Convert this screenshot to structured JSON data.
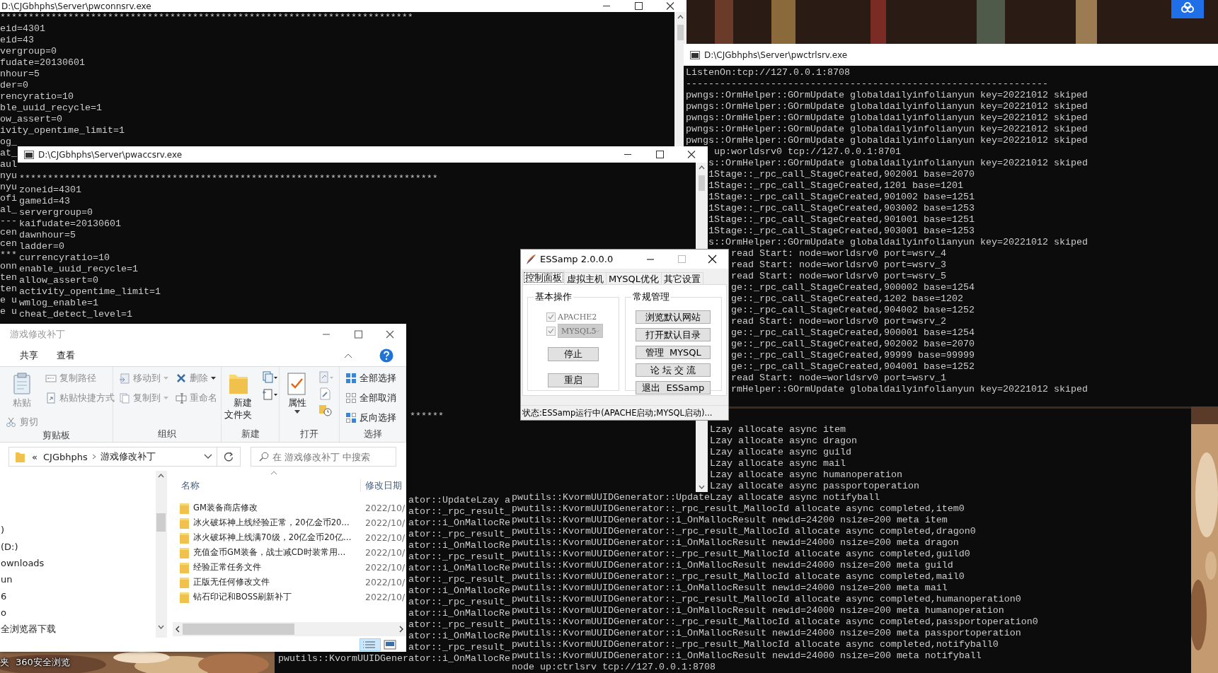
{
  "desktop": {
    "kind": "picture",
    "labels": [
      "夹",
      "360安全浏览"
    ]
  },
  "consoles": [
    {
      "title": "D:\\CJGbhphs\\Server\\pwconnsrv.exe",
      "segments": [
        {
          "lines": [
            "*************************************************************************",
            "eid=4301",
            "eid=43",
            "vergroup=0",
            "fudate=20130601",
            "nhour=5",
            "der=0",
            "rencyratio=10",
            "ble_uuid_recycle=1",
            "ow_assert=0",
            "ivity_opentime_limit=1"
          ]
        },
        {
          "lines": [
            "og_",
            "at_",
            "aul",
            "nyu",
            "nyu",
            "ofi",
            "al_",
            "---",
            "cen",
            "cen",
            "***",
            "onn",
            "ten",
            "ten",
            "e u",
            "e u"
          ]
        }
      ]
    },
    {
      "title": "D:\\CJGbhphs\\Server\\pwaccsrv.exe",
      "segments": [
        {
          "lines": [
            "**************************************************************************",
            "zoneid=4301",
            "gameid=43",
            "servergroup=0",
            "kaifudate=20130601",
            "dawnhour=5",
            "ladder=0",
            "currencyratio=10",
            "enable_uuid_recycle=1",
            "allow_assert=0",
            "activity_opentime_limit=1",
            "wmlog_enable=1",
            "cheat_detect_level=1"
          ]
        },
        {
          "lines": [
            "******"
          ]
        }
      ]
    },
    {
      "title": "D:\\CJGbhphs\\Server\\pwctrlsrv.exe",
      "segments": [
        {
          "lines": [
            "ListenOn:tcp://127.0.0.1:8708",
            "----------------------------------------------------------------",
            "pwngs::OrmHelper::GOrmUpdate globaldailyinfolianyun key=20221012 skiped",
            "pwngs::OrmHelper::GOrmUpdate globaldailyinfolianyun key=20221012 skiped",
            "pwngs::OrmHelper::GOrmUpdate globaldailyinfolianyun key=20221012 skiped",
            "pwngs::OrmHelper::GOrmUpdate globaldailyinfolianyun key=20221012 skiped",
            "pwngs::OrmHelper::GOrmUpdate globaldailyinfolianyun key=20221012 skiped"
          ]
        },
        {
          "lines": [
            " up:worldsrv0 tcp://127.0.0.1:8701",
            "s::OrmHelper::GOrmUpdate globaldailyinfolianyun key=20221012 skiped",
            "1Stage::_rpc_call_StageCreated,902001 base=2070",
            "1Stage::_rpc_call_StageCreated,1201 base=1201",
            "1Stage::_rpc_call_StageCreated,901002 base=1251",
            "1Stage::_rpc_call_StageCreated,903002 base=1253",
            "1Stage::_rpc_call_StageCreated,901001 base=1251",
            "1Stage::_rpc_call_StageCreated,903001 base=1253",
            "s::OrmHelper::GOrmUpdate globaldailyinfolianyun key=20221012 skiped"
          ]
        },
        {
          "lines": [
            "read Start: node=worldsrv0 port=wsrv_4",
            "read Start: node=worldsrv0 port=wsrv_3",
            "read Start: node=worldsrv0 port=wsrv_5",
            "ge::_rpc_call_StageCreated,900002 base=1254",
            "ge::_rpc_call_StageCreated,1202 base=1202",
            "ge::_rpc_call_StageCreated,904002 base=1252",
            "read Start: node=worldsrv0 port=wsrv_2",
            "ge::_rpc_call_StageCreated,900001 base=1254",
            "ge::_rpc_call_StageCreated,902002 base=2070",
            "ge::_rpc_call_StageCreated,99999 base=99999",
            "ge::_rpc_call_StageCreated,904001 base=1252",
            "read Start: node=worldsrv0 port=wsrv_1",
            "rmHelper::GOrmUpdate globaldailyinfolianyun key=20221012 skiped"
          ]
        }
      ]
    },
    {
      "segments": [
        {
          "lines": [
            "ator::UpdateLzay a",
            "ator::_rpc_result_",
            "ator::i_OnMallocRe",
            "ator::_rpc_result_",
            "ator::i_OnMallocRe",
            "ator::_rpc_result_",
            "ator::i_OnMallocRe",
            "ator::_rpc_result_",
            "ator::i_OnMallocRe",
            "ator::_rpc_result_",
            "ator::i_OnMallocRe",
            "ator::_rpc_result_",
            "ator::i_OnMallocRe",
            "ator::_rpc_result_"
          ]
        },
        {
          "lines": [
            "pwutils::KvormUUIDGenerator::i_OnMallocRe"
          ]
        }
      ]
    },
    {
      "segments": [
        {
          "lines": [
            "Lzay allocate async item",
            "Lzay allocate async dragon",
            "Lzay allocate async guild",
            "Lzay allocate async mail",
            "Lzay allocate async humanoperation",
            "Lzay allocate async passportoperation"
          ]
        },
        {
          "lines": [
            "pwutils::KvormUUIDGenerator::UpdateLzay allocate async notifyball",
            "pwutils::KvormUUIDGenerator::_rpc_result_MallocId allocate async completed,item0",
            "pwutils::KvormUUIDGenerator::i_OnMallocResult newid=24200 nsize=200 meta item",
            "pwutils::KvormUUIDGenerator::_rpc_result_MallocId allocate async completed,dragon0",
            "pwutils::KvormUUIDGenerator::i_OnMallocResult newid=24000 nsize=200 meta dragon",
            "pwutils::KvormUUIDGenerator::_rpc_result_MallocId allocate async completed,guild0",
            "pwutils::KvormUUIDGenerator::i_OnMallocResult newid=24000 nsize=200 meta guild",
            "pwutils::KvormUUIDGenerator::_rpc_result_MallocId allocate async completed,mail0",
            "pwutils::KvormUUIDGenerator::i_OnMallocResult newid=24000 nsize=200 meta mail",
            "pwutils::KvormUUIDGenerator::_rpc_result_MallocId allocate async completed,humanoperation0",
            "pwutils::KvormUUIDGenerator::i_OnMallocResult newid=24000 nsize=200 meta humanoperation",
            "pwutils::KvormUUIDGenerator::_rpc_result_MallocId allocate async completed,passportoperation0",
            "pwutils::KvormUUIDGenerator::i_OnMallocResult newid=24000 nsize=200 meta passportoperation",
            "pwutils::KvormUUIDGenerator::_rpc_result_MallocId allocate async completed,notifyball0",
            "pwutils::KvormUUIDGenerator::i_OnMallocResult newid=24000 nsize=200 meta notifyball",
            "node up:ctrlsrv tcp://127.0.0.1:8708"
          ]
        }
      ]
    }
  ],
  "explorer": {
    "title": "游戏修改补丁",
    "tabs": [
      "共享",
      "查看"
    ],
    "ribbon_groups": [
      {
        "label": "剪贴板",
        "items": [
          {
            "label": "粘贴",
            "kind": "large",
            "disabled": true
          },
          {
            "label": "剪切",
            "kind": "small",
            "disabled": true
          },
          {
            "label": "复制路径",
            "kind": "small",
            "disabled": true
          },
          {
            "label": "粘贴快捷方式",
            "kind": "small",
            "disabled": true
          }
        ]
      },
      {
        "label": "组织",
        "items": [
          {
            "label": "移动到",
            "kind": "small",
            "disabled": true
          },
          {
            "label": "复制到",
            "kind": "small",
            "disabled": true
          },
          {
            "label": "删除",
            "kind": "small",
            "disabled": true
          },
          {
            "label": "重命名",
            "kind": "small",
            "disabled": true
          }
        ]
      },
      {
        "label": "新建",
        "items": [
          {
            "label": "新建文件夹",
            "kind": "large",
            "disabled": false
          }
        ]
      },
      {
        "label": "打开",
        "items": [
          {
            "label": "属性",
            "kind": "large",
            "disabled": false
          }
        ]
      },
      {
        "label": "选择",
        "items": [
          {
            "label": "全部选择",
            "kind": "small",
            "disabled": false
          },
          {
            "label": "全部取消",
            "kind": "small",
            "disabled": false
          },
          {
            "label": "反向选择",
            "kind": "small",
            "disabled": false
          }
        ]
      }
    ],
    "address": {
      "overflow": "«",
      "path": [
        "CJGbhphs",
        "游戏修改补丁"
      ]
    },
    "search": {
      "placeholder": "在 游戏修改补丁 中搜索"
    },
    "nav_items": [
      ")",
      "(D:)",
      "ownloads",
      "un",
      "6",
      "o",
      "全浏览器下载"
    ],
    "columns": [
      "名称",
      "修改日期"
    ],
    "rows": [
      {
        "name": "GM装备商店修改",
        "date": "2022/10/"
      },
      {
        "name": "冰火破坏神上线经验正常，20亿金币20…",
        "date": "2022/10/"
      },
      {
        "name": "冰火破坏神上线满70级，20亿金币20亿…",
        "date": "2022/10/"
      },
      {
        "name": "充值金币GM装备，战士减CD时装常用…",
        "date": "2022/10/"
      },
      {
        "name": "经验正常任务文件",
        "date": "2022/10/"
      },
      {
        "name": "正版无任何修改文件",
        "date": "2022/10/"
      },
      {
        "name": "钻石印记和BOSS刷新补丁",
        "date": "2022/10/"
      }
    ]
  },
  "essamp": {
    "title": "ESSamp 2.0.0.0",
    "tabs": [
      {
        "label": "控制面板",
        "selected": true
      },
      {
        "label": "虚拟主机",
        "selected": false
      },
      {
        "label": "MYSQL优化",
        "selected": false
      },
      {
        "label": "其它设置",
        "selected": false
      }
    ],
    "basic": {
      "label": "基本操作",
      "checks": [
        {
          "label": "APACHE2",
          "checked": true,
          "disabled": true
        },
        {
          "select": "MYSQL5",
          "checked": true,
          "disabled": true
        }
      ],
      "buttons": [
        "停止",
        "重启"
      ]
    },
    "manage": {
      "label": "常规管理",
      "buttons": [
        "浏览默认网站",
        "打开默认目录",
        "管理  MYSQL",
        "论 坛 交 流",
        "退出  ESSamp"
      ]
    },
    "status": "状态:ESSamp运行中(APACHE启动;MYSQL启动)..."
  }
}
